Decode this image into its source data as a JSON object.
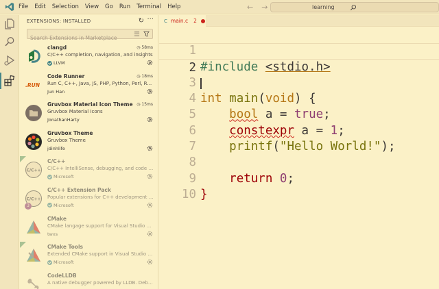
{
  "menu": [
    "File",
    "Edit",
    "Selection",
    "View",
    "Go",
    "Run",
    "Terminal",
    "Help"
  ],
  "nav": {
    "back": "←",
    "forward": "→"
  },
  "command_center": {
    "text": "learning"
  },
  "sidebar": {
    "title": "EXTENSIONS: INSTALLED",
    "search_placeholder": "Search Extensions in Marketplace"
  },
  "extensions": [
    {
      "name": "clangd",
      "desc": "C/C++ completion, navigation, and insights",
      "publisher": "LLVM",
      "verified": true,
      "time": "58ms",
      "enabled": true
    },
    {
      "name": "Code Runner",
      "desc": "Run C, C++, Java, JS, PHP, Python, Perl, Ruby,...",
      "publisher": "Jun Han",
      "verified": false,
      "time": "18ms",
      "enabled": true
    },
    {
      "name": "Gruvbox Material Icon Theme",
      "desc": "Gruvbox Material Icons",
      "publisher": "JonathanHarty",
      "verified": false,
      "time": "15ms",
      "enabled": true
    },
    {
      "name": "Gruvbox Theme",
      "desc": "Gruvbox Theme",
      "publisher": "jdinhlife",
      "verified": false,
      "time": "",
      "enabled": true
    },
    {
      "name": "C/C++",
      "desc": "C/C++ IntelliSense, debugging, and code br...",
      "publisher": "Microsoft",
      "verified": true,
      "time": "",
      "enabled": false
    },
    {
      "name": "C/C++ Extension Pack",
      "desc": "Popular extensions for C++ development in ...",
      "publisher": "Microsoft",
      "verified": true,
      "time": "",
      "enabled": false,
      "badge": "3"
    },
    {
      "name": "CMake",
      "desc": "CMake langage support for Visual Studio Code",
      "publisher": "twxs",
      "verified": false,
      "time": "",
      "enabled": false
    },
    {
      "name": "CMake Tools",
      "desc": "Extended CMake support in Visual Studio Co...",
      "publisher": "Microsoft",
      "verified": true,
      "time": "",
      "enabled": false
    },
    {
      "name": "CodeLLDB",
      "desc": "A native debugger powered by LLDB. Debug ...",
      "publisher": "",
      "verified": false,
      "time": "",
      "enabled": false
    }
  ],
  "tab": {
    "lang": "C",
    "filename": "main.c",
    "errors": "2"
  },
  "code": {
    "line_numbers": [
      "1",
      "2",
      "3",
      "4",
      "5",
      "6",
      "7",
      "8",
      "9",
      "10"
    ],
    "l1": {
      "pp": "#include",
      "hdr": "<stdio.h>"
    },
    "l3": {
      "ty": "int",
      "fn": "main",
      "open": "(",
      "param": "void",
      "close": ") {"
    },
    "l4": {
      "ty": "bool",
      "var": " a = ",
      "val": "true",
      "end": ";"
    },
    "l5": {
      "kw": "constexpr",
      "var": " a = ",
      "num": "1",
      "end": ";"
    },
    "l6": {
      "fn": "printf",
      "open": "(",
      "str": "\"Hello World!\"",
      "close": ");"
    },
    "l8": {
      "kw": "return",
      "num": "0",
      "end": ";"
    },
    "l9": {
      "close": "}"
    }
  }
}
